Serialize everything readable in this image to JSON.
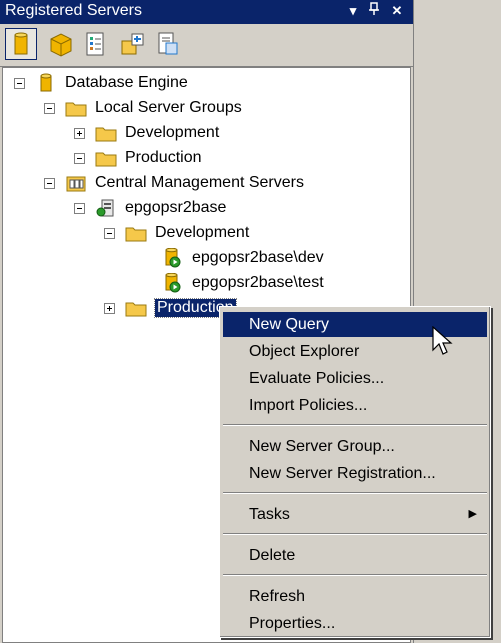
{
  "window": {
    "title": "Registered Servers",
    "title_icons": [
      "dropdown-icon",
      "pin-icon",
      "close-icon"
    ]
  },
  "toolbar": {
    "buttons": [
      "database-engine-icon",
      "analysis-services-icon",
      "reporting-services-icon",
      "integration-services-icon",
      "sql-compact-icon"
    ]
  },
  "tree": {
    "nodes": [
      {
        "label": "Database Engine",
        "icon": "database-icon",
        "expanded": true
      },
      {
        "label": "Local Server Groups",
        "icon": "folder-icon",
        "expanded": true
      },
      {
        "label": "Development",
        "icon": "folder-icon",
        "expanded": false
      },
      {
        "label": "Production",
        "icon": "folder-icon",
        "expanded": true
      },
      {
        "label": "Central Management Servers",
        "icon": "cms-icon",
        "expanded": true
      },
      {
        "label": "epgopsr2base",
        "icon": "server-icon",
        "expanded": true
      },
      {
        "label": "Development",
        "icon": "folder-icon",
        "expanded": true
      },
      {
        "label": "epgopsr2base\\dev",
        "icon": "server-running-icon"
      },
      {
        "label": "epgopsr2base\\test",
        "icon": "server-running-icon"
      },
      {
        "label": "Production",
        "icon": "folder-icon",
        "expanded": false,
        "selected": true
      }
    ]
  },
  "context_menu": {
    "items": [
      {
        "label": "New Query",
        "highlighted": true
      },
      {
        "label": "Object Explorer"
      },
      {
        "label": "Evaluate Policies..."
      },
      {
        "label": "Import Policies..."
      },
      {
        "label": "New Server Group..."
      },
      {
        "label": "New Server Registration..."
      },
      {
        "label": "Tasks",
        "submenu": true
      },
      {
        "label": "Delete"
      },
      {
        "label": "Refresh"
      },
      {
        "label": "Properties..."
      }
    ]
  },
  "colors": {
    "title_bar": "#0a246a",
    "selection": "#0a246a",
    "folder": "#f5c84a",
    "database": "#f0b400"
  }
}
